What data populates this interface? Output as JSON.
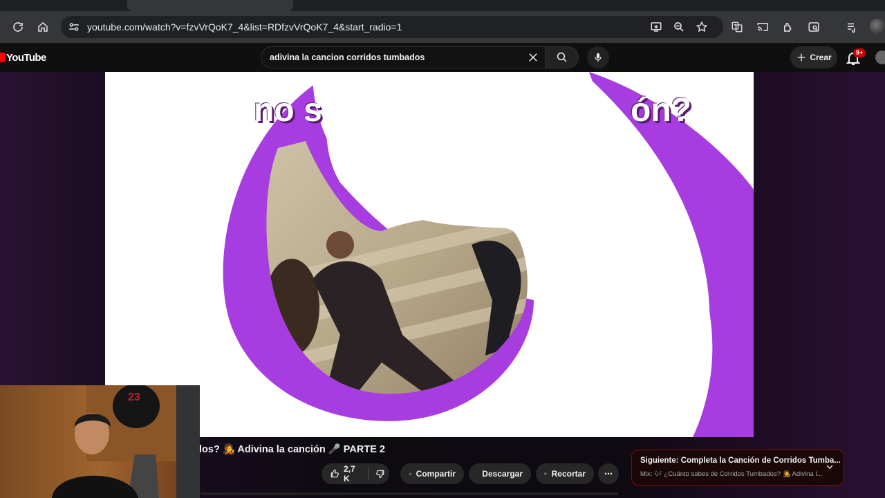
{
  "browser": {
    "url": "youtube.com/watch?v=fzvVrQoK7_4&list=RDfzvVrQoK7_4&start_radio=1",
    "icons": [
      "reload-icon",
      "home-icon",
      "site-info-icon",
      "install-app-icon",
      "zoom-icon",
      "bookmark-star-icon",
      "translate-icon",
      "cast-icon",
      "extensions-icon",
      "side-panel-icon",
      "media-controls-icon",
      "profile-avatar"
    ]
  },
  "youtube": {
    "logo_text": "YouTube",
    "search_query": "adivina la cancion corridos tumbados",
    "create_label": "Crear",
    "notifications_badge": "9+"
  },
  "video": {
    "overlay_title_left": "no s",
    "overlay_title_right": "ón?",
    "accent_color": "#a73de0"
  },
  "below_video": {
    "title": "los? 🧑‍🎤 Adivina la canción 🎤 PARTE 2",
    "like_count": "2,7 K",
    "share_label": "Compartir",
    "download_label": "Descargar",
    "clip_label": "Recortar",
    "more_label": "⋯"
  },
  "next_up": {
    "title": "Siguiente: Completa la Canción de Corridos Tumba...",
    "subtitle": "Mix: 🎶 ¿Cuánto sabes de Corridos Tumbados? 🧑‍🎤 Adivina l..."
  },
  "colors": {
    "brand_red": "#ff0000",
    "badge_red": "#cc0000",
    "purple": "#a73de0"
  }
}
